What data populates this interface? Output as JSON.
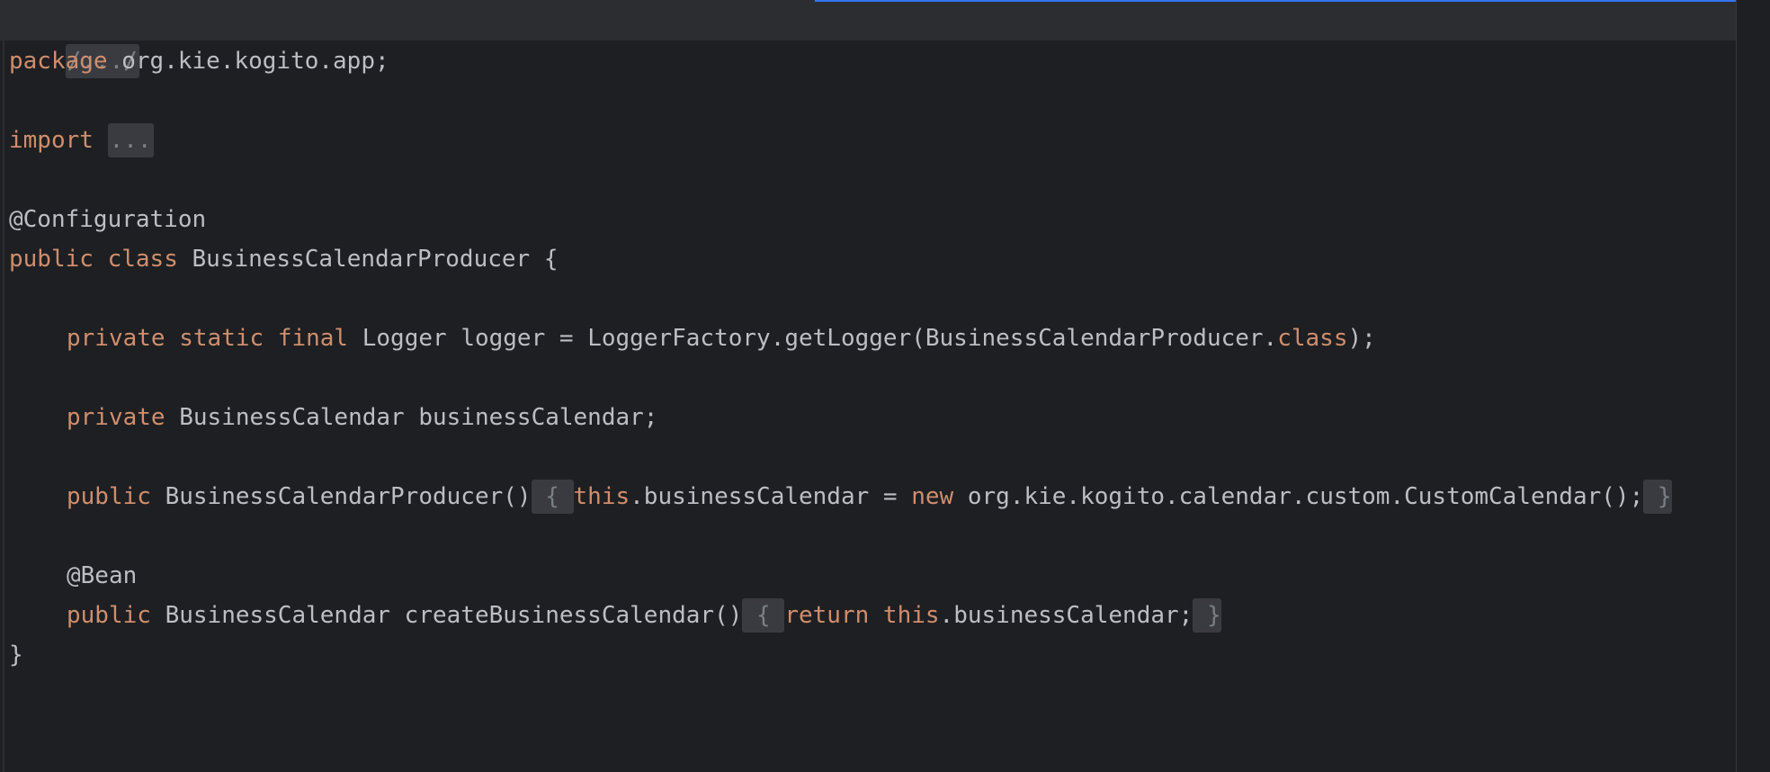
{
  "editor": {
    "header_fold": "/.../",
    "package_kw": "package",
    "package_name": " org.kie.kogito.app;",
    "import_kw": "import",
    "import_fold": "...",
    "class_annotation": "@Configuration",
    "class_public_kw": "public",
    "class_kw": "class",
    "class_decl_rest": " BusinessCalendarProducer {",
    "field1": {
      "private_kw": "private",
      "static_kw": "static",
      "final_kw": "final",
      "decl": " Logger logger = LoggerFactory.getLogger(BusinessCalendarProducer.",
      "class_kw": "class",
      "tail": ");"
    },
    "field2": {
      "private_kw": "private",
      "decl": " BusinessCalendar businessCalendar;"
    },
    "ctor": {
      "public_kw": "public",
      "signature": " BusinessCalendarProducer()",
      "open_fold": " { ",
      "this_kw": "this",
      "assign": ".businessCalendar = ",
      "new_kw": "new",
      "expr": " org.kie.kogito.calendar.custom.CustomCalendar();",
      "close_fold": " }"
    },
    "bean_annotation": "@Bean",
    "method": {
      "public_kw": "public",
      "signature": " BusinessCalendar createBusinessCalendar()",
      "open_fold": " { ",
      "return_kw": "return",
      "this_kw": "this",
      "expr": ".businessCalendar;",
      "close_fold": " }"
    },
    "class_close": "}"
  },
  "colors": {
    "background": "#1e1f22",
    "keyword": "#cf8e6d",
    "text": "#bcbec4",
    "fold_bg": "#393b40",
    "accent": "#3574f0"
  }
}
